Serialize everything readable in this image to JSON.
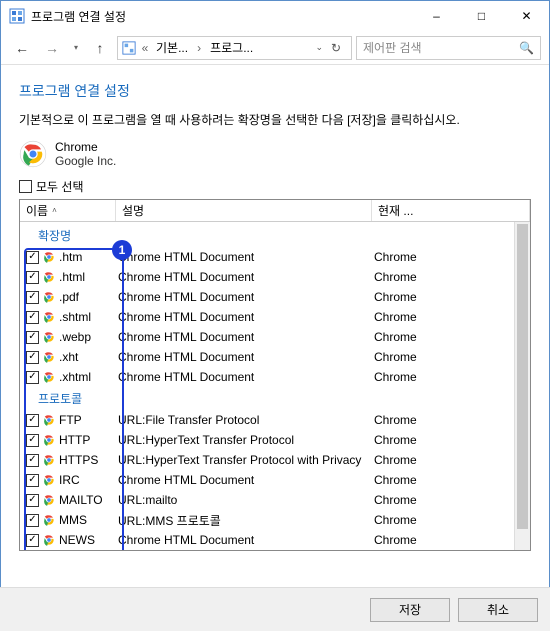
{
  "window": {
    "title": "프로그램 연결 설정",
    "minimize": "–",
    "maximize": "□",
    "close": "✕"
  },
  "toolbar": {
    "breadcrumb": [
      "기본...",
      "프로그...",
      "..."
    ],
    "search_placeholder": "제어판 검색"
  },
  "page": {
    "heading": "프로그램 연결 설정",
    "subtext": "기본적으로 이 프로그램을 열 때 사용하려는 확장명을 선택한 다음 [저장]을 클릭하십시오.",
    "program_name": "Chrome",
    "vendor": "Google Inc.",
    "select_all": "모두 선택"
  },
  "columns": {
    "name": "이름",
    "desc": "설명",
    "current": "현재 ..."
  },
  "callout": {
    "number": "1"
  },
  "groups": [
    {
      "label": "확장명",
      "rows": [
        {
          "checked": true,
          "name": ".htm",
          "desc": "Chrome HTML Document",
          "current": "Chrome"
        },
        {
          "checked": true,
          "name": ".html",
          "desc": "Chrome HTML Document",
          "current": "Chrome"
        },
        {
          "checked": true,
          "name": ".pdf",
          "desc": "Chrome HTML Document",
          "current": "Chrome"
        },
        {
          "checked": true,
          "name": ".shtml",
          "desc": "Chrome HTML Document",
          "current": "Chrome"
        },
        {
          "checked": true,
          "name": ".webp",
          "desc": "Chrome HTML Document",
          "current": "Chrome"
        },
        {
          "checked": true,
          "name": ".xht",
          "desc": "Chrome HTML Document",
          "current": "Chrome"
        },
        {
          "checked": true,
          "name": ".xhtml",
          "desc": "Chrome HTML Document",
          "current": "Chrome"
        }
      ]
    },
    {
      "label": "프로토콜",
      "rows": [
        {
          "checked": true,
          "name": "FTP",
          "desc": "URL:File Transfer Protocol",
          "current": "Chrome"
        },
        {
          "checked": true,
          "name": "HTTP",
          "desc": "URL:HyperText Transfer Protocol",
          "current": "Chrome"
        },
        {
          "checked": true,
          "name": "HTTPS",
          "desc": "URL:HyperText Transfer Protocol with Privacy",
          "current": "Chrome"
        },
        {
          "checked": true,
          "name": "IRC",
          "desc": "Chrome HTML Document",
          "current": "Chrome"
        },
        {
          "checked": true,
          "name": "MAILTO",
          "desc": "URL:mailto",
          "current": "Chrome"
        },
        {
          "checked": true,
          "name": "MMS",
          "desc": "URL:MMS 프로토콜",
          "current": "Chrome"
        },
        {
          "checked": true,
          "name": "NEWS",
          "desc": "Chrome HTML Document",
          "current": "Chrome"
        }
      ]
    }
  ],
  "footer": {
    "save": "저장",
    "cancel": "취소"
  }
}
